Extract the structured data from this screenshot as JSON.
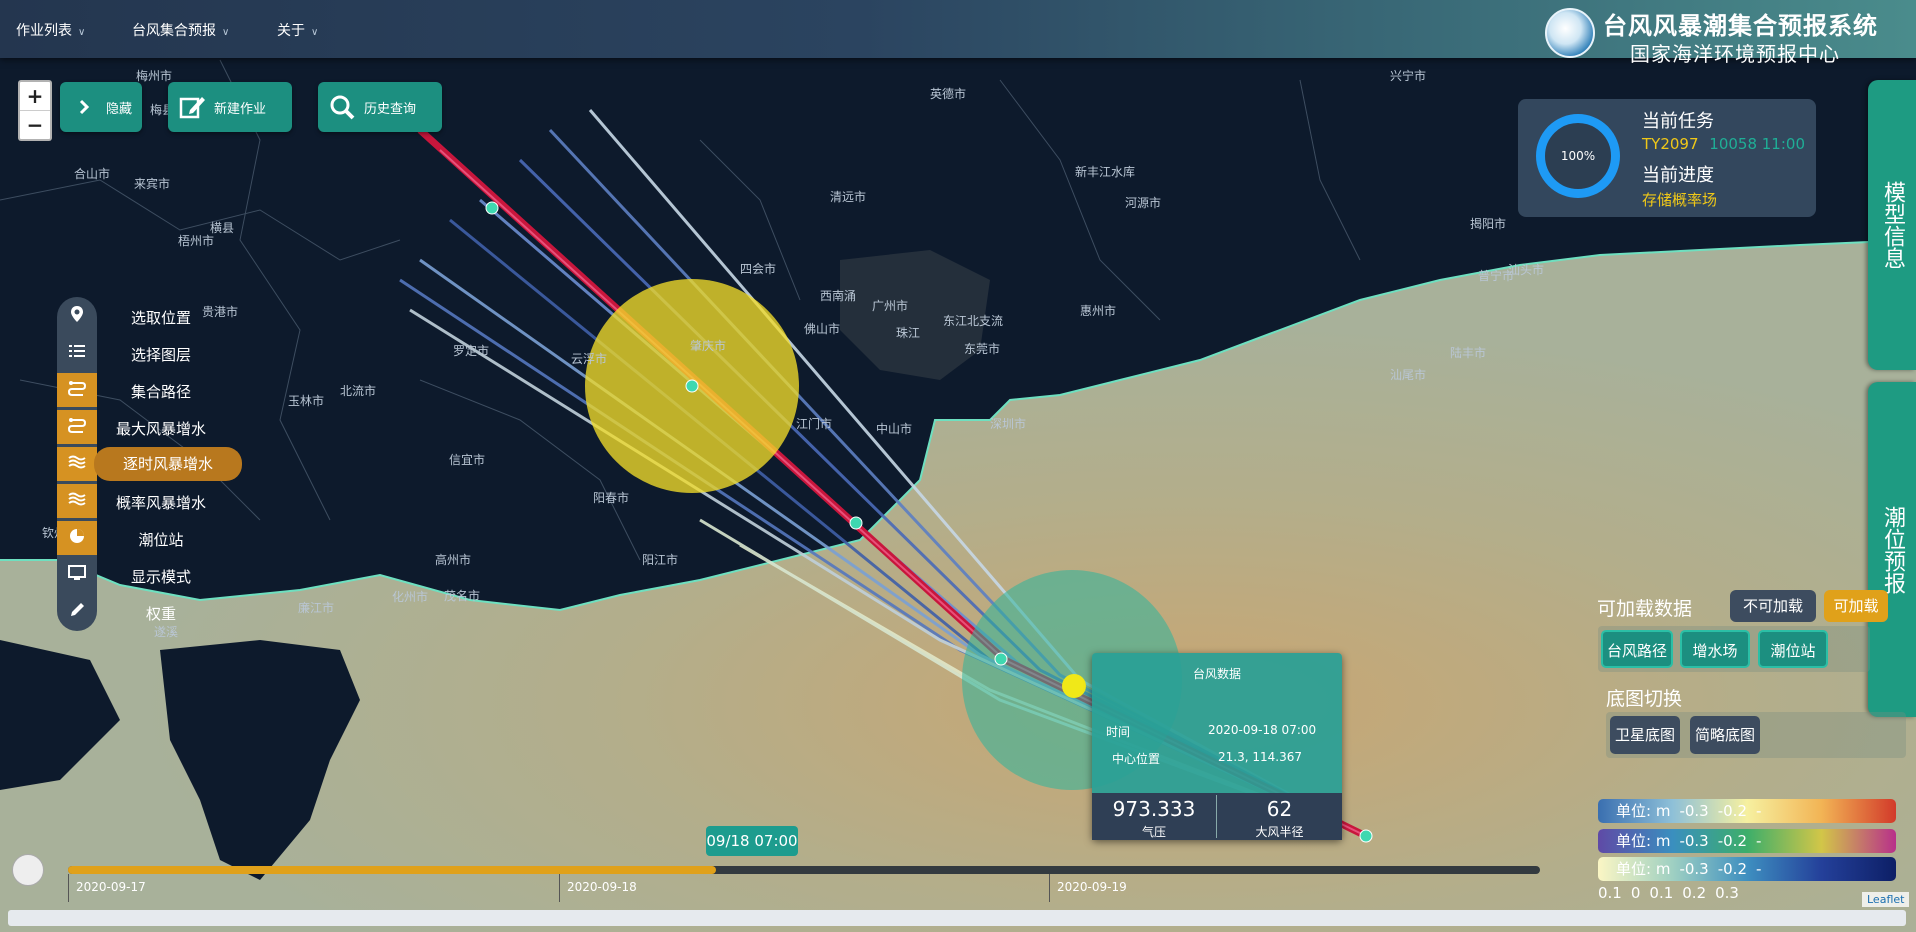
{
  "nav": {
    "menu": [
      {
        "label": "作业列表"
      },
      {
        "label": "台风集合预报"
      },
      {
        "label": "关于"
      }
    ]
  },
  "header": {
    "title": "台风风暴潮集合预报系统",
    "subtitle": "国家海洋环境预报中心"
  },
  "map": {
    "zoom_in": "+",
    "zoom_out": "−",
    "attribution": "Leaflet",
    "city_labels": [
      "梅州市",
      "兴宁市",
      "梅县",
      "英德市",
      "河源市",
      "新丰江水库",
      "清远市",
      "四会市",
      "西南涌",
      "广州市",
      "佛山市",
      "东江北支流",
      "东莞市",
      "惠州市",
      "揭阳市",
      "普宁市",
      "汕头市",
      "陆丰市",
      "汕尾市",
      "深圳市",
      "中山市",
      "江门市",
      "珠江",
      "阳春市",
      "阳江市",
      "云浮市",
      "肇庆市",
      "罗定市",
      "梧州市",
      "贵港市",
      "玉林市",
      "北流市",
      "信宜市",
      "高州市",
      "化州市",
      "茂名市",
      "廉江市",
      "遂溪",
      "来宾市",
      "合山市",
      "横县",
      "钦州市"
    ]
  },
  "toolbar": {
    "hide_label": "隐藏",
    "new_job_label": "新建作业",
    "history_label": "历史查询"
  },
  "sidebar": {
    "items": [
      {
        "label": "选取位置",
        "icon": "map-pin-icon",
        "on": false
      },
      {
        "label": "选择图层",
        "icon": "list-icon",
        "on": false
      },
      {
        "label": "集合路径",
        "icon": "route-icon",
        "on": true
      },
      {
        "label": "最大风暴增水",
        "icon": "route-icon",
        "on": true
      },
      {
        "label": "逐时风暴增水",
        "icon": "wave-icon",
        "on": true,
        "active": true
      },
      {
        "label": "概率风暴增水",
        "icon": "wave-icon",
        "on": true
      },
      {
        "label": "潮位站",
        "icon": "pie-icon",
        "on": true
      },
      {
        "label": "显示模式",
        "icon": "monitor-icon",
        "on": false
      },
      {
        "label": "权重",
        "icon": "pen-icon",
        "on": false
      }
    ]
  },
  "task": {
    "progress_text": "100%",
    "progress": 1.0,
    "current_task_label": "当前任务",
    "task_id": "TY2097",
    "task_suffix": "10058 11:00",
    "current_progress_label": "当前进度",
    "progress_status": "存储概率场"
  },
  "side_tabs": {
    "model_info": "模型信息",
    "tide_forecast": "潮位预报"
  },
  "right_panel": {
    "loadable_title": "可加载数据",
    "not_loadable": "不可加载",
    "loadable": "可加载",
    "layers": [
      "台风路径",
      "增水场",
      "潮位站"
    ],
    "basemap_title": "底图切换",
    "basemaps": [
      "卫星底图",
      "简略底图"
    ]
  },
  "legends": [
    {
      "unit": "单位: m",
      "ticks": [
        "-0.3",
        "-0.2",
        "-0.1",
        "0",
        "0.1",
        "0.2",
        "0.3"
      ],
      "colors": [
        "#3a6fb0",
        "#8ec0d8",
        "#f6f0a0",
        "#f2b455",
        "#d23a2a"
      ]
    },
    {
      "unit": "单位: m",
      "ticks": [
        "-0.3",
        "-0.2",
        "-0.1",
        "0",
        "0.1",
        "0.2",
        "0.3"
      ],
      "colors": [
        "#5f4aa6",
        "#3a8fbf",
        "#3cae6a",
        "#d2c648",
        "#b8308a"
      ]
    },
    {
      "unit": "单位: m",
      "ticks": [
        "-0.3",
        "-0.2",
        "-0.1",
        "0",
        "0.1",
        "0.2",
        "0.3"
      ],
      "colors": [
        "#fbf6c4",
        "#9fd0c2",
        "#3e8fc0",
        "#24409a",
        "#0d1f66"
      ]
    }
  ],
  "popup": {
    "title": "台风数据",
    "time_label": "时间",
    "time_value": "2020-09-18 07:00",
    "center_label": "中心位置",
    "center_value": "21.3, 114.367",
    "pressure_value": "973.333",
    "pressure_label": "气压",
    "radius_value": "62",
    "radius_label": "大风半径"
  },
  "timeline": {
    "current": "09/18 07:00",
    "progress": 0.44,
    "dates": [
      "2020-09-17",
      "2020-09-18",
      "2020-09-19"
    ]
  },
  "colors": {
    "accent": "#1c8f80",
    "warning": "#e0a11a",
    "active_sidebar": "#d69222",
    "task_yellow": "#f0c818",
    "track_red": "#c8163c"
  }
}
